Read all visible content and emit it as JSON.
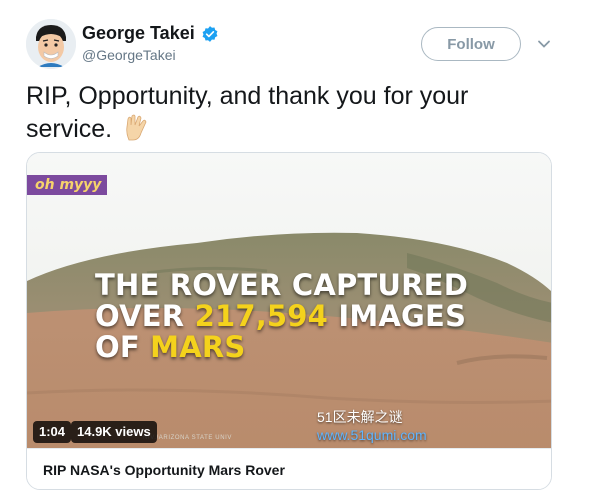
{
  "user": {
    "display_name": "George Takei",
    "handle": "@GeorgeTakei",
    "verified": true
  },
  "header": {
    "follow_label": "Follow"
  },
  "tweet": {
    "text": "RIP, Opportunity, and thank you for your service.",
    "emoji": "vulcan-salute-icon"
  },
  "card": {
    "brand_tag": "oh myyy",
    "headline_lines": [
      [
        "THE ROVER CAPTURED"
      ],
      [
        "OVER ",
        "217,594",
        " IMAGES"
      ],
      [
        "OF ",
        "MARS"
      ]
    ],
    "duration": "1:04",
    "views": "14.9K views",
    "credit": "NIV./ARIZONA STATE UNIV",
    "title": "RIP NASA's Opportunity Mars Rover",
    "watermark_cn": "51区未解之谜",
    "watermark_url": "www.51qumi.com"
  },
  "colors": {
    "accent": "#1da1f2",
    "headline_highlight": "#f4d21c",
    "brand_bg": "#7c4a9e"
  }
}
